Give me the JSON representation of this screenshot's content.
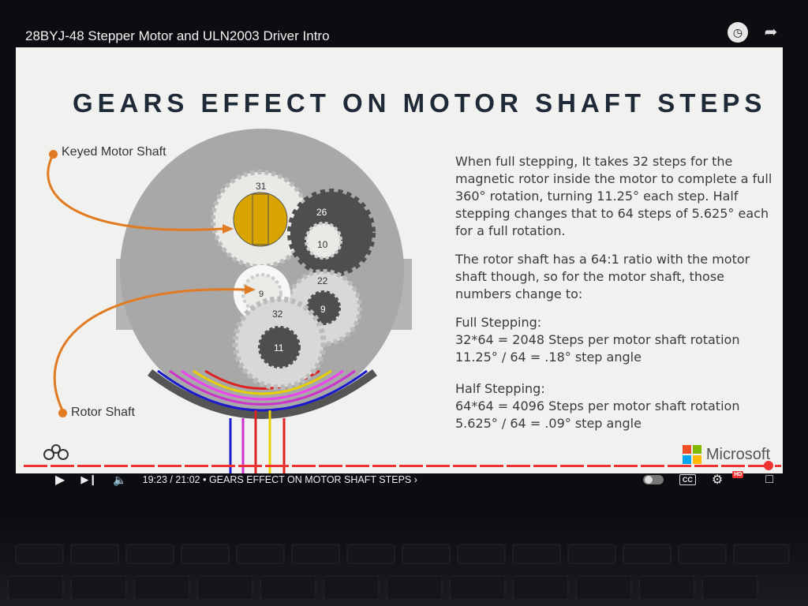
{
  "window": {
    "video_title": "28BYJ-48 Stepper Motor and ULN2003 Driver Intro"
  },
  "slide": {
    "title": "GEARS EFFECT ON MOTOR SHAFT STEPS",
    "callouts": {
      "keyed_motor_shaft": "Keyed Motor Shaft",
      "rotor_shaft": "Rotor Shaft"
    },
    "gear_labels": {
      "g31": "31",
      "g26": "26",
      "g10": "10",
      "g22": "22",
      "g9a": "9",
      "g9b": "9",
      "g32": "32",
      "g11": "11"
    },
    "paragraph1": "When full stepping, It takes 32 steps for the magnetic rotor inside the motor to complete a full 360° rotation, turning 11.25° each step.  Half stepping changes that to 64 steps of 5.625° each for a full rotation.",
    "paragraph2": "The rotor shaft has a 64:1 ratio with the motor shaft though, so for the motor shaft, those numbers change to:",
    "full_heading": "Full Stepping:",
    "full_line1": "32*64 = 2048 Steps per motor shaft rotation",
    "full_line2": "11.25° / 64 = .18° step angle",
    "half_heading": "Half Stepping:",
    "half_line1": "64*64 = 4096 Steps per motor shaft rotation",
    "half_line2": "5.625° / 64 = .09° step angle",
    "brand": "Microsoft"
  },
  "player": {
    "time": "19:23 / 21:02",
    "chapter": "• GEARS EFFECT ON MOTOR SHAFT STEPS",
    "progress_fraction": 0.92,
    "cc_label": "CC",
    "hd_label": "HD"
  },
  "colors": {
    "accent": "#e07b22",
    "progress": "#e33333",
    "title": "#1f2a38"
  },
  "icons": {
    "watch_later": "clock-icon",
    "share": "share-icon",
    "play": "play-icon",
    "next": "next-icon",
    "volume": "volume-icon",
    "settings": "gear-icon",
    "exit_fullscreen": "exit-fullscreen-icon"
  }
}
